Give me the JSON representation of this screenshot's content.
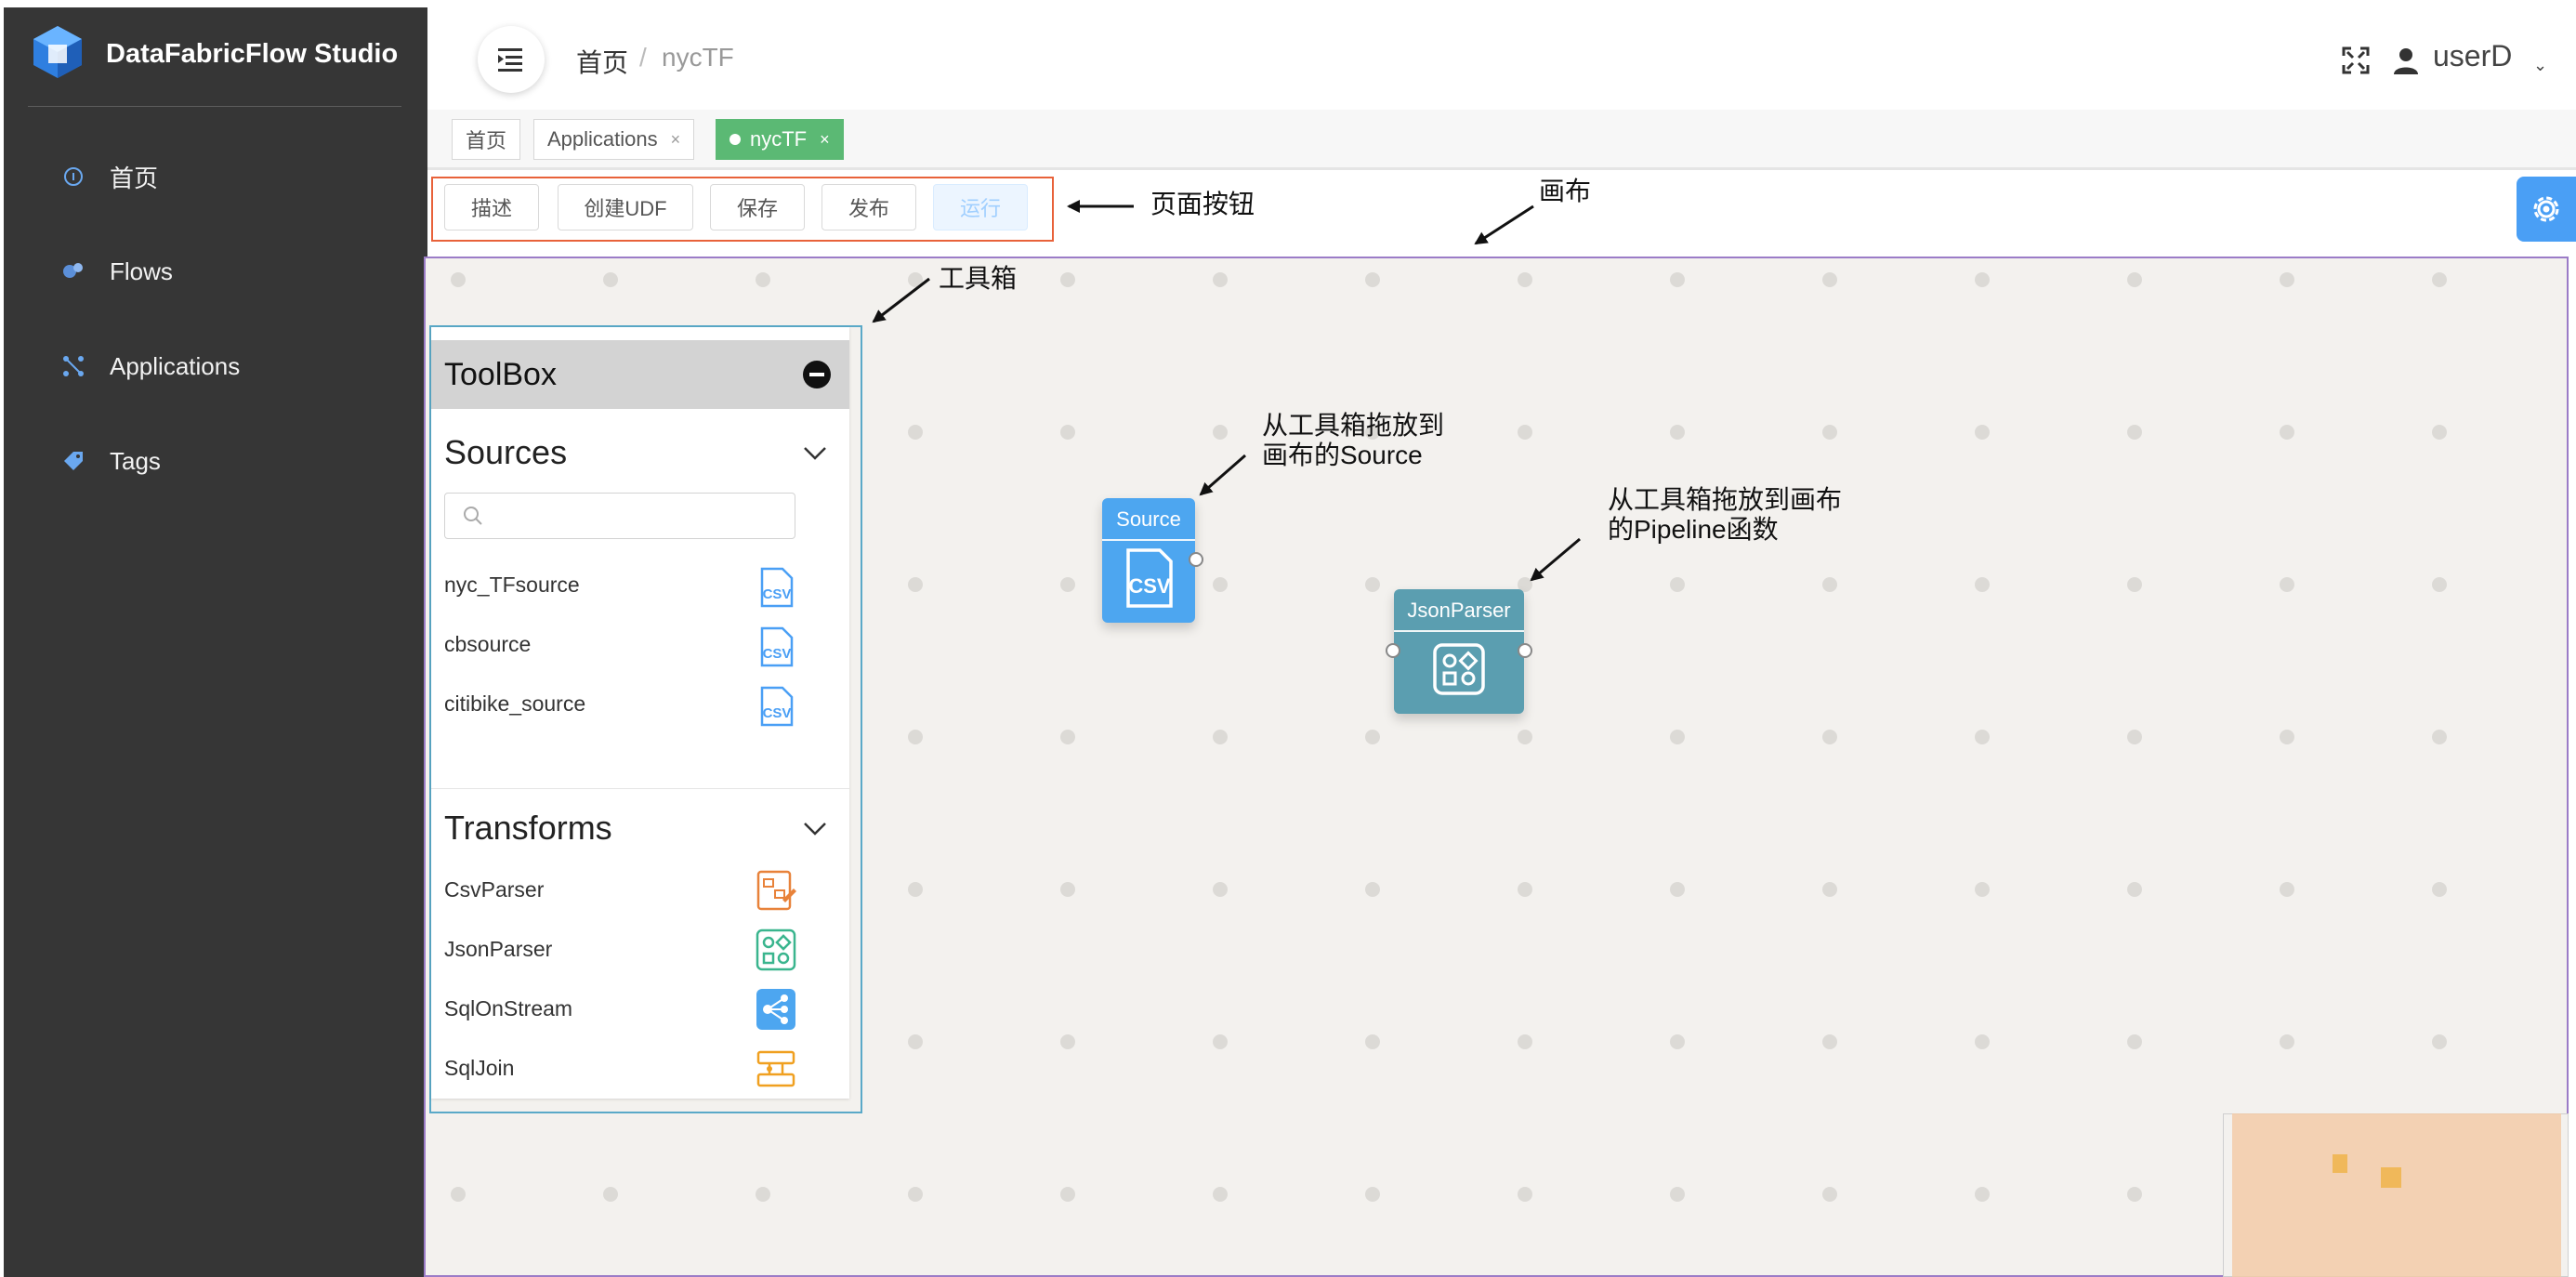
{
  "sidebar": {
    "app_title": "DataFabricFlow Studio",
    "items": [
      {
        "label": "首页",
        "icon": "home-icon"
      },
      {
        "label": "Flows",
        "icon": "flows-icon"
      },
      {
        "label": "Applications",
        "icon": "applications-icon"
      },
      {
        "label": "Tags",
        "icon": "tag-icon"
      }
    ]
  },
  "header": {
    "breadcrumb": {
      "home": "首页",
      "separator": "/",
      "current": "nycTF"
    },
    "user": "userD"
  },
  "tabs": [
    {
      "label": "首页"
    },
    {
      "label": "Applications",
      "close": "×"
    },
    {
      "label": "nycTF",
      "close": "×",
      "active": true
    }
  ],
  "toolbar": {
    "describe": "描述",
    "create_udf": "创建UDF",
    "save": "保存",
    "publish": "发布",
    "run": "运行"
  },
  "toolbox": {
    "title": "ToolBox",
    "sources": {
      "title": "Sources",
      "search_placeholder": "",
      "items": [
        {
          "label": "nyc_TFsource",
          "icon": "csv-icon"
        },
        {
          "label": "cbsource",
          "icon": "csv-icon"
        },
        {
          "label": "citibike_source",
          "icon": "csv-icon"
        }
      ]
    },
    "transforms": {
      "title": "Transforms",
      "items": [
        {
          "label": "CsvParser",
          "icon": "csv-parser-icon"
        },
        {
          "label": "JsonParser",
          "icon": "json-parser-icon"
        },
        {
          "label": "SqlOnStream",
          "icon": "sql-stream-icon"
        },
        {
          "label": "SqlJoin",
          "icon": "sql-join-icon"
        }
      ]
    }
  },
  "canvas": {
    "nodes": [
      {
        "title": "Source",
        "icon": "csv-icon",
        "color": "#4da6f0"
      },
      {
        "title": "JsonParser",
        "icon": "json-parser-icon",
        "color": "#5b9eb0"
      }
    ]
  },
  "annotations": {
    "page_buttons": "页面按钮",
    "canvas": "画布",
    "toolbox": "工具箱",
    "drag_source_line1": "从工具箱拖放到",
    "drag_source_line2": "画布的Source",
    "drag_pipeline_line1": "从工具箱拖放到画布",
    "drag_pipeline_line2": "的Pipeline函数"
  },
  "colors": {
    "sidebar_bg": "#363636",
    "active_tab": "#5bb974",
    "primary_blue": "#4a9ff5",
    "canvas_border": "#9b7cc7",
    "toolbar_frame": "#e8623a",
    "toolbox_frame": "#5aa9c8"
  }
}
